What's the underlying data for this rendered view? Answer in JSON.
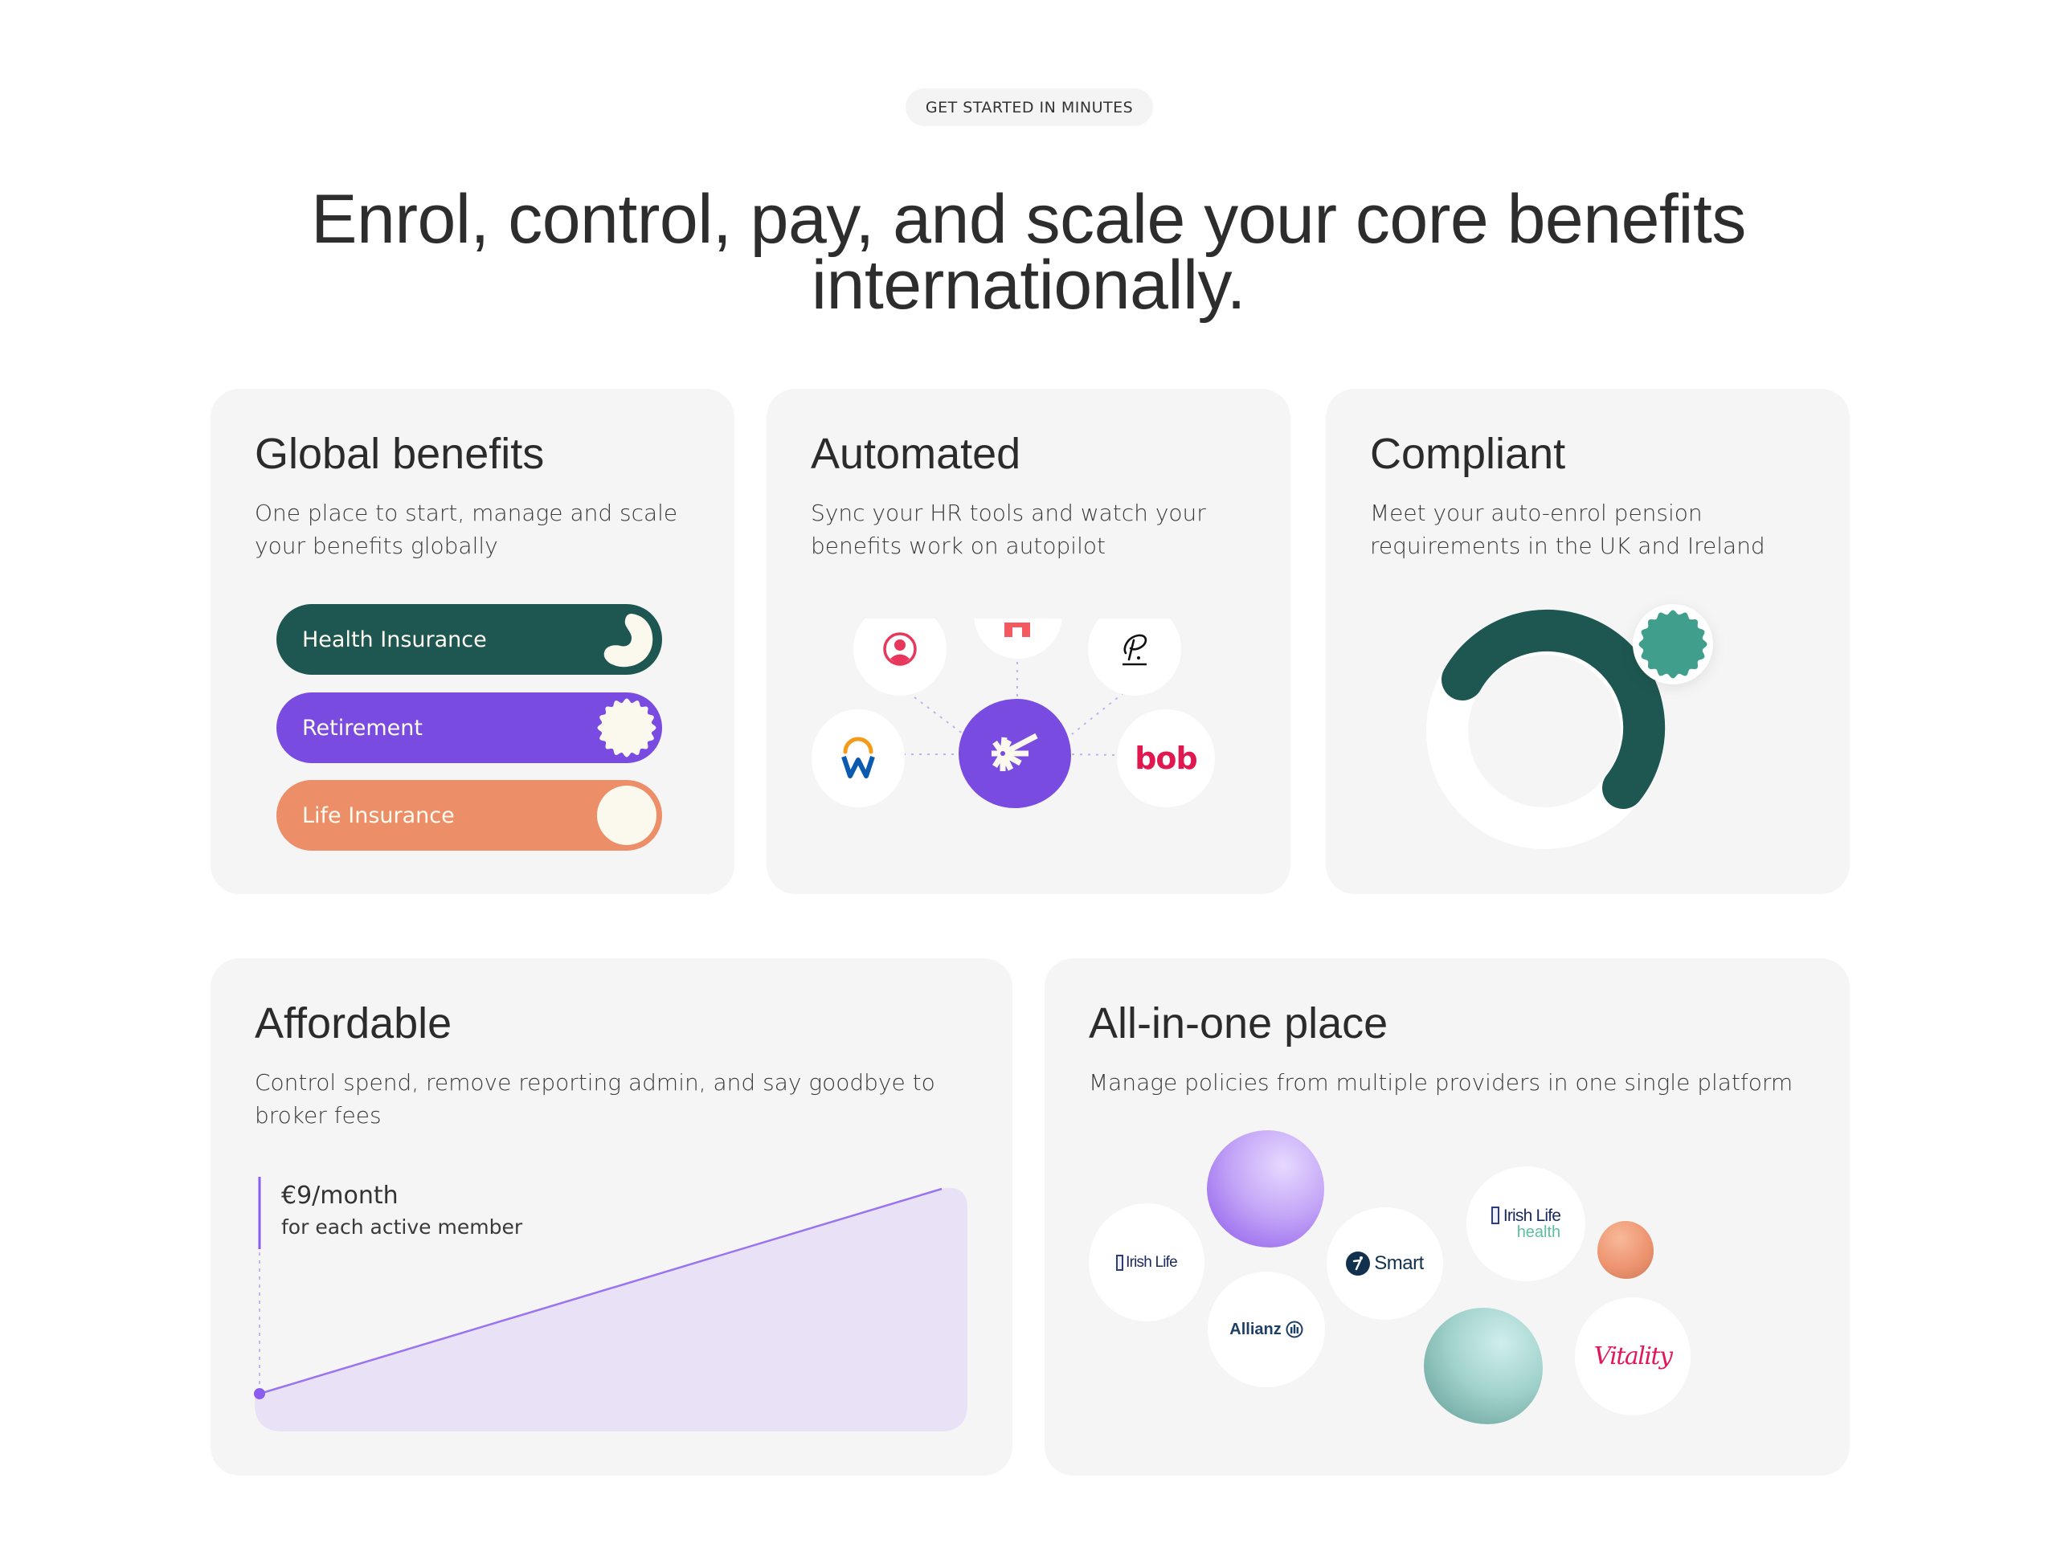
{
  "header": {
    "eyebrow": "GET STARTED IN MINUTES",
    "headline_line1": "Enrol, control, pay, and scale your core benefits",
    "headline_line2": "internationally."
  },
  "cards": {
    "global": {
      "title": "Global benefits",
      "description": "One place to start, manage and scale your benefits globally",
      "toggles": [
        {
          "label": "Health Insurance",
          "color": "#1e5751"
        },
        {
          "label": "Retirement",
          "color": "#7a4be0"
        },
        {
          "label": "Life Insurance",
          "color": "#ec8e68"
        }
      ]
    },
    "automated": {
      "title": "Automated",
      "description": "Sync your HR tools and watch your benefits work on autopilot",
      "integrations": [
        {
          "name": "personio-style person icon"
        },
        {
          "name": "red block icon"
        },
        {
          "name": "signature P icon"
        },
        {
          "name": "Workday",
          "glyph": "W"
        },
        {
          "name": "HiBob",
          "glyph": "bob"
        }
      ],
      "hub_color": "#7a4be0"
    },
    "compliant": {
      "title": "Compliant",
      "description": "Meet your auto-enrol pension requirements in the UK and Ireland",
      "ring_color": "#1e5751",
      "badge_color": "#3f9e8c"
    },
    "affordable": {
      "title": "Affordable",
      "description": "Control spend, remove reporting admin, and say goodbye to broker fees",
      "price": "€9/month",
      "price_note": "for each active member",
      "accent": "#8a5cf0"
    },
    "allinone": {
      "title": "All-in-one place",
      "description": "Manage policies from multiple providers in one single platform",
      "providers": [
        {
          "name": "Irish Life"
        },
        {
          "name": "Allianz"
        },
        {
          "name": "Smart"
        },
        {
          "name": "Irish Life",
          "sub": "health"
        },
        {
          "name": "Vitality"
        }
      ]
    }
  }
}
